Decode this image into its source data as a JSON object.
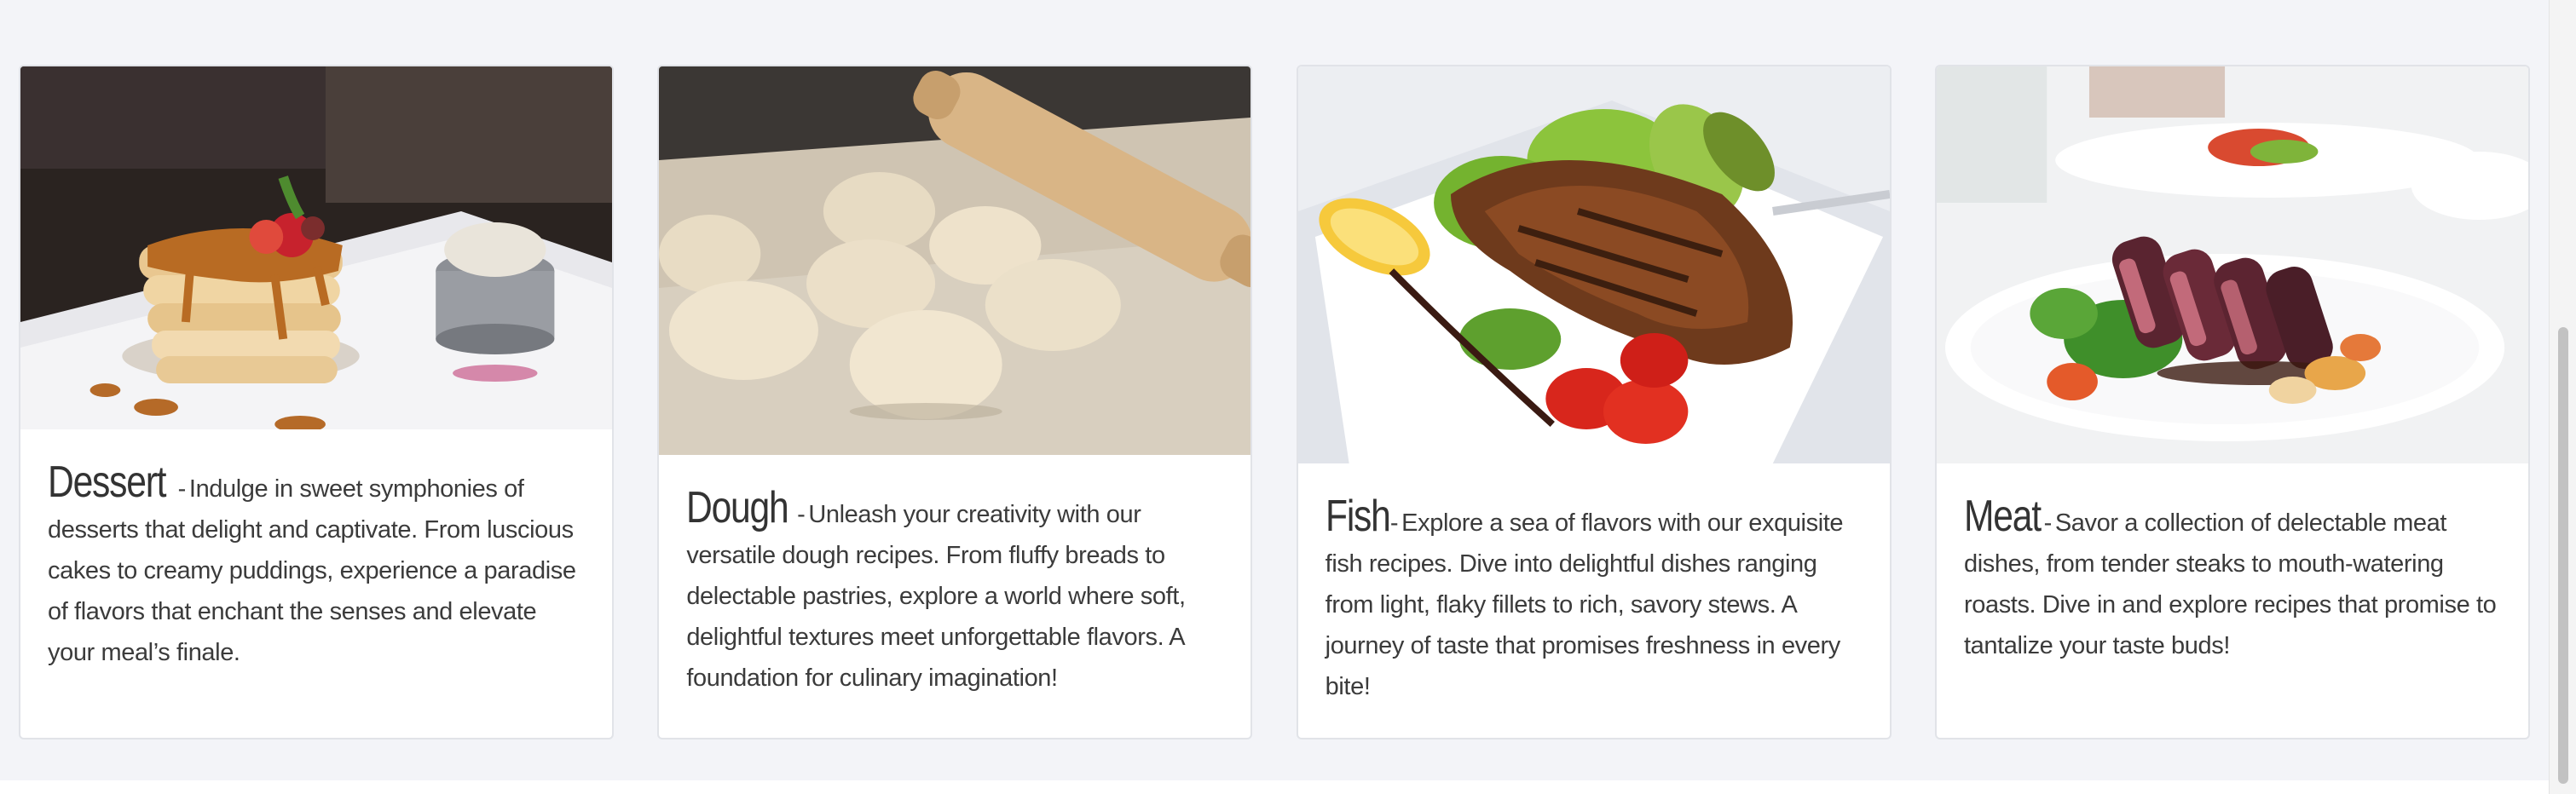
{
  "cards": [
    {
      "title": "Dessert",
      "separator": "-",
      "description": "Indulge in sweet symphonies of desserts that delight and captivate. From luscious cakes to creamy puddings, experience a paradise of flavors that enchant the senses and elevate your meal’s finale.",
      "image_subject": "pancake-stack-photo"
    },
    {
      "title": "Dough",
      "separator": "-",
      "description": "Unleash your creativity with our versatile dough recipes. From fluffy breads to delectable pastries, explore a world where soft, delightful textures meet unforgettable flavors. A foundation for culinary imagination!",
      "image_subject": "dough-balls-rolling-pin-photo"
    },
    {
      "title": "Fish",
      "separator": "-",
      "description": "Explore a sea of flavors with our exquisite fish recipes. Dive into delightful dishes ranging from light, flaky fillets to rich, savory stews. A journey of taste that promises freshness in every bite!",
      "image_subject": "grilled-salmon-plate-photo"
    },
    {
      "title": "Meat",
      "separator": "-",
      "description": "Savor a collection of delectable meat dishes, from tender steaks to mouth-watering roasts. Dive in and explore recipes that promise to tantalize your taste buds!",
      "image_subject": "sliced-meat-plate-photo"
    }
  ],
  "colors": {
    "page_background": "#f3f4f8",
    "card_background": "#ffffff",
    "card_border": "#e1e3e8",
    "text": "#3b3b3b"
  }
}
